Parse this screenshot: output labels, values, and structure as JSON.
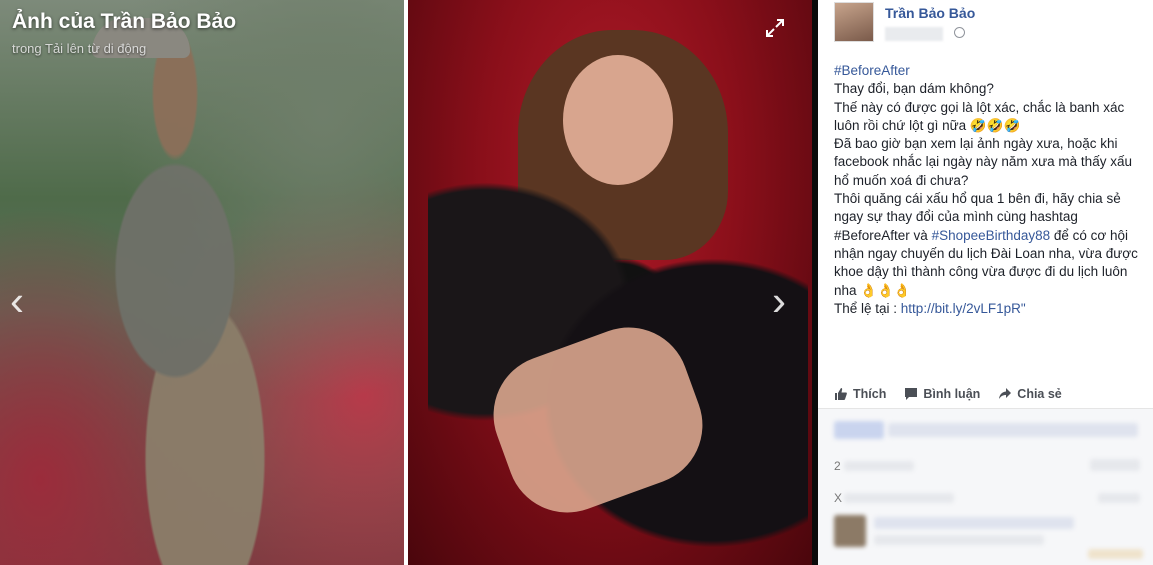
{
  "viewer": {
    "title": "Ảnh của Trần Bảo Bảo",
    "subtitle": "trong Tải lên từ di động",
    "prev_symbol": "‹",
    "next_symbol": "›"
  },
  "post": {
    "author": "Trần Bảo Bảo",
    "lines": [
      {
        "text": "#BeforeAfter",
        "link": true
      },
      {
        "text": "Thay đổi, bạn dám không?"
      },
      {
        "text": "Thế này có được gọi là lột xác, chắc là banh xác"
      },
      {
        "text": "luôn rồi chứ lột gì nữa 🤣🤣🤣"
      },
      {
        "text": "Đã bao giờ bạn xem lại ảnh ngày xưa, hoặc khi"
      },
      {
        "text": "facebook nhắc lại ngày này năm xưa mà thấy xấu"
      },
      {
        "text": "hổ muốn xoá đi chưa?"
      },
      {
        "text": "Thôi quăng cái xấu hổ qua 1 bên đi, hãy chia sẻ"
      },
      {
        "text": "ngay sự thay đổi của mình cùng hashtag"
      },
      {
        "pre": "#BeforeAfter và ",
        "link_text": "#ShopeeBirthday88",
        "post": " để có cơ hội"
      },
      {
        "text": "nhận ngay chuyến du lịch Đài Loan nha, vừa được"
      },
      {
        "text": "khoe dậy thì thành công vừa được đi du lịch luôn"
      },
      {
        "text": "nha 👌👌👌"
      },
      {
        "pre": "Thể lệ tại : ",
        "link_text": "http://bit.ly/2vLF1pR\"",
        "post": ""
      }
    ]
  },
  "actions": {
    "like": "Thích",
    "comment": "Bình luận",
    "share": "Chia sẻ"
  },
  "comments": {
    "row2_prefix": "2",
    "row3_prefix": "X"
  },
  "colors": {
    "link": "#365899",
    "text": "#1d2129",
    "action": "#4b4f56"
  }
}
